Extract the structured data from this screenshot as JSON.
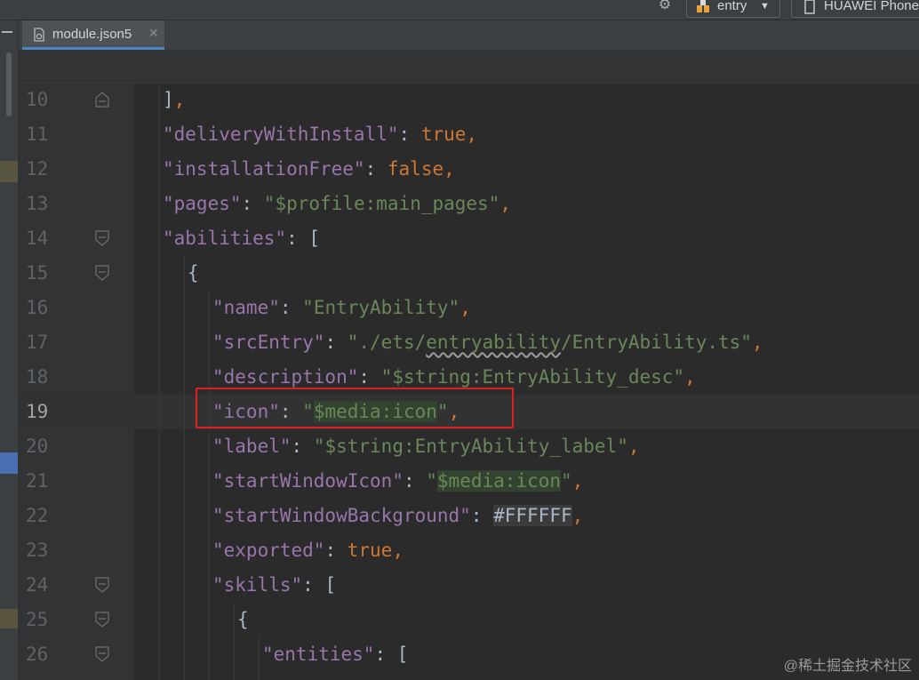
{
  "toolbar": {
    "run_config_label": "entry",
    "device_label": "HUAWEI Phone",
    "settings_icon": "gear-icon"
  },
  "tabs": [
    {
      "label": "module.json5",
      "icon": "json-file-icon",
      "active": true
    }
  ],
  "editor": {
    "current_line": 19,
    "lines": [
      {
        "n": "10",
        "fold": "end",
        "text": "],"
      },
      {
        "n": "11",
        "fold": "",
        "text": "\"deliveryWithInstall\": true,"
      },
      {
        "n": "12",
        "fold": "",
        "text": "\"installationFree\": false,"
      },
      {
        "n": "13",
        "fold": "",
        "text": "\"pages\": \"$profile:main_pages\","
      },
      {
        "n": "14",
        "fold": "start",
        "text": "\"abilities\": ["
      },
      {
        "n": "15",
        "fold": "start",
        "text": "{"
      },
      {
        "n": "16",
        "fold": "",
        "text": "\"name\": \"EntryAbility\","
      },
      {
        "n": "17",
        "fold": "",
        "text": "\"srcEntry\": \"./ets/entryability/EntryAbility.ts\","
      },
      {
        "n": "18",
        "fold": "",
        "text": "\"description\": \"$string:EntryAbility_desc\","
      },
      {
        "n": "19",
        "fold": "",
        "text": "\"icon\": \"$media:icon\","
      },
      {
        "n": "20",
        "fold": "",
        "text": "\"label\": \"$string:EntryAbility_label\","
      },
      {
        "n": "21",
        "fold": "",
        "text": "\"startWindowIcon\": \"$media:icon\","
      },
      {
        "n": "22",
        "fold": "",
        "text": "\"startWindowBackground\": #FFFFFF,"
      },
      {
        "n": "23",
        "fold": "",
        "text": "\"exported\": true,"
      },
      {
        "n": "24",
        "fold": "start",
        "text": "\"skills\": ["
      },
      {
        "n": "25",
        "fold": "start",
        "text": "{"
      },
      {
        "n": "26",
        "fold": "start",
        "text": "\"entities\": ["
      }
    ]
  },
  "watermark": "@稀土掘金技术社区",
  "colors": {
    "key": "#9876aa",
    "string": "#6a8759",
    "keyword": "#cc7832",
    "highlight_border": "#e02020"
  }
}
